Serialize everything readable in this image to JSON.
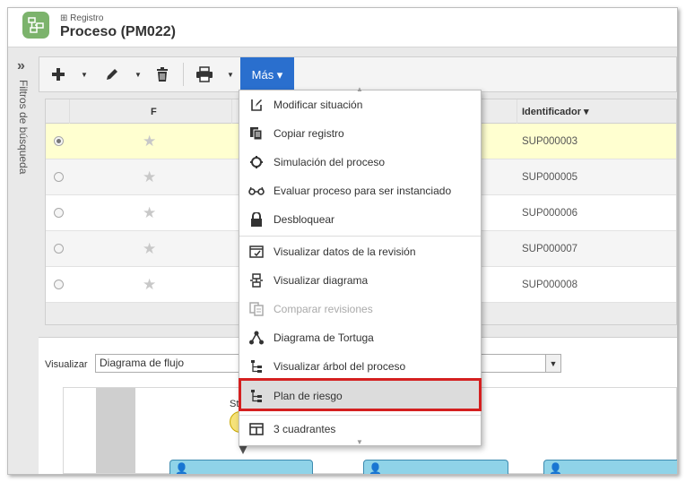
{
  "header": {
    "supertitle": "⊞ Registro",
    "title": "Proceso (PM022)"
  },
  "sidebar": {
    "toggle": "»",
    "label": "Filtros de búsqueda"
  },
  "toolbar": {
    "more_label": "Más ▾"
  },
  "grid": {
    "columns": {
      "col_f": "F",
      "col_identificador": "Identificador ▾"
    },
    "rows": [
      {
        "identificador": "SUP000003",
        "selected": true
      },
      {
        "identificador": "SUP000005",
        "selected": false
      },
      {
        "identificador": "SUP000006",
        "selected": false
      },
      {
        "identificador": "SUP000007",
        "selected": false
      },
      {
        "identificador": "SUP000008",
        "selected": false
      }
    ]
  },
  "viewer": {
    "label": "Visualizar",
    "selected": "Diagrama de flujo",
    "start_label": "St"
  },
  "menu": {
    "items": [
      {
        "label": "Modificar situación",
        "icon": "edit-status-icon"
      },
      {
        "label": "Copiar registro",
        "icon": "copy-icon"
      },
      {
        "label": "Simulación del proceso",
        "icon": "simulation-icon"
      },
      {
        "label": "Evaluar proceso para ser instanciado",
        "icon": "glasses-icon"
      },
      {
        "label": "Desbloquear",
        "icon": "lock-icon"
      },
      {
        "label": "Visualizar datos de la revisión",
        "icon": "revision-data-icon"
      },
      {
        "label": "Visualizar diagrama",
        "icon": "diagram-icon"
      },
      {
        "label": "Comparar revisiones",
        "icon": "compare-icon",
        "disabled": true
      },
      {
        "label": "Diagrama de Tortuga",
        "icon": "turtle-diagram-icon"
      },
      {
        "label": "Visualizar árbol del proceso",
        "icon": "process-tree-icon"
      },
      {
        "label": "Plan de riesgo",
        "icon": "risk-plan-icon",
        "highlighted": true
      },
      {
        "label": "3 cuadrantes",
        "icon": "quadrants-icon"
      }
    ]
  },
  "colors": {
    "accent": "#2a6fce",
    "highlight_border": "#d42020",
    "selected_row": "#ffffd0",
    "node_fill": "#8fd3e8"
  }
}
